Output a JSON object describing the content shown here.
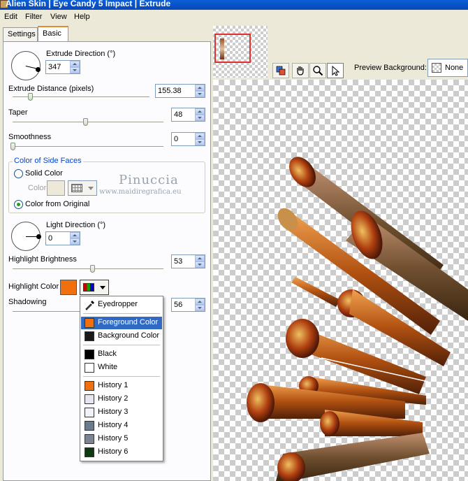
{
  "window": {
    "title": "Alien Skin | Eye Candy 5 Impact | Extrude"
  },
  "menu": [
    "Edit",
    "Filter",
    "View",
    "Help"
  ],
  "tabs": [
    {
      "label": "Settings"
    },
    {
      "label": "Basic"
    }
  ],
  "basic": {
    "extrude_direction_label": "Extrude Direction (°)",
    "extrude_direction_value": "347",
    "extrude_distance_label": "Extrude Distance (pixels)",
    "extrude_distance_value": "155.38",
    "extrude_distance_level": 0.13,
    "taper_label": "Taper",
    "taper_value": "48",
    "taper_level": 0.48,
    "smoothness_label": "Smoothness",
    "smoothness_value": "0",
    "smoothness_level": 0.0,
    "side_faces": {
      "title": "Color of Side Faces",
      "solid_label": "Solid Color",
      "color_label": "Color",
      "original_label": "Color from Original",
      "selected": "original"
    },
    "light_direction_label": "Light Direction (°)",
    "light_direction_value": "0",
    "highlight_brightness_label": "Highlight Brightness",
    "highlight_brightness_value": "53",
    "highlight_brightness_level": 0.53,
    "highlight_color_label": "Highlight Color",
    "highlight_color": "#f07010",
    "shadowing_label": "Shadowing",
    "shadowing_value": "56"
  },
  "watermark": {
    "line1": "Pinuccia",
    "line2": "www.maidiregrafica.eu"
  },
  "color_menu": {
    "eyedropper": "Eyedropper",
    "items": [
      {
        "label": "Foreground Color",
        "color": "#f07010",
        "selected": true
      },
      {
        "label": "Background Color",
        "color": "#1a1a1a"
      },
      {
        "label": "Black",
        "color": "#000000"
      },
      {
        "label": "White",
        "color": "#ffffff"
      },
      {
        "label": "History 1",
        "color": "#f07010"
      },
      {
        "label": "History 2",
        "color": "#e4e8ee"
      },
      {
        "label": "History 3",
        "color": "#f0f3f8"
      },
      {
        "label": "History 4",
        "color": "#6b7a8f"
      },
      {
        "label": "History 5",
        "color": "#7d8594"
      },
      {
        "label": "History 6",
        "color": "#0e3a12"
      }
    ]
  },
  "preview": {
    "background_label": "Preview Background:",
    "background_value": "None"
  },
  "colors": {
    "accent_tab": "#e68b2c",
    "selection": "#316ac5",
    "title_blue": "#0a5fd8"
  }
}
